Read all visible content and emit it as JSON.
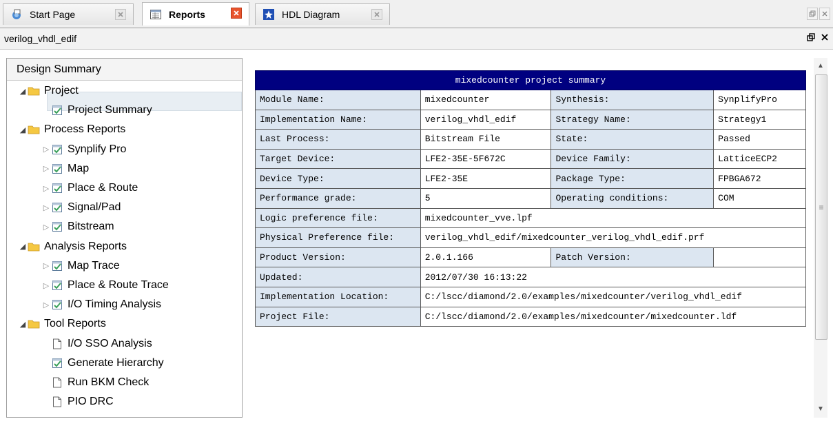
{
  "tabs": [
    {
      "label": "Start Page",
      "icon": "start-page-icon"
    },
    {
      "label": "Reports",
      "icon": "reports-icon",
      "active": true
    },
    {
      "label": "HDL Diagram",
      "icon": "hdl-diagram-icon"
    }
  ],
  "titlebar": {
    "title": "verilog_vhdl_edif"
  },
  "tree": {
    "header": "Design Summary",
    "items": [
      {
        "label": "Project",
        "icon": "folder-icon",
        "level": 0,
        "expanded": true
      },
      {
        "label": "Project Summary",
        "icon": "report-check-icon",
        "level": 1,
        "selected": true
      },
      {
        "label": "Process Reports",
        "icon": "folder-icon",
        "level": 0,
        "expanded": true
      },
      {
        "label": "Synplify Pro",
        "icon": "report-check-icon",
        "level": 1,
        "expandable": true
      },
      {
        "label": "Map",
        "icon": "report-check-icon",
        "level": 1,
        "expandable": true
      },
      {
        "label": "Place & Route",
        "icon": "report-check-icon",
        "level": 1,
        "expandable": true
      },
      {
        "label": "Signal/Pad",
        "icon": "report-check-icon",
        "level": 1,
        "expandable": true
      },
      {
        "label": "Bitstream",
        "icon": "report-check-icon",
        "level": 1,
        "expandable": true
      },
      {
        "label": "Analysis Reports",
        "icon": "folder-icon",
        "level": 0,
        "expanded": true
      },
      {
        "label": "Map Trace",
        "icon": "report-check-icon",
        "level": 1,
        "expandable": true
      },
      {
        "label": "Place & Route Trace",
        "icon": "report-check-icon",
        "level": 1,
        "expandable": true
      },
      {
        "label": "I/O Timing Analysis",
        "icon": "report-check-icon",
        "level": 1,
        "expandable": true
      },
      {
        "label": "Tool Reports",
        "icon": "folder-icon",
        "level": 0,
        "expanded": true
      },
      {
        "label": "I/O SSO Analysis",
        "icon": "document-icon",
        "level": 1
      },
      {
        "label": "Generate Hierarchy",
        "icon": "report-check-icon",
        "level": 1
      },
      {
        "label": "Run BKM Check",
        "icon": "document-icon",
        "level": 1
      },
      {
        "label": "PIO DRC",
        "icon": "document-icon",
        "level": 1
      }
    ]
  },
  "summary": {
    "title": "mixedcounter project summary",
    "rows": [
      [
        "Module Name:",
        "mixedcounter",
        "Synthesis:",
        "SynplifyPro"
      ],
      [
        "Implementation Name:",
        "verilog_vhdl_edif",
        "Strategy Name:",
        "Strategy1"
      ],
      [
        "Last Process:",
        "Bitstream File",
        "State:",
        "Passed"
      ],
      [
        "Target Device:",
        "LFE2-35E-5F672C",
        "Device Family:",
        "LatticeECP2"
      ],
      [
        "Device Type:",
        "LFE2-35E",
        "Package Type:",
        "FPBGA672"
      ],
      [
        "Performance grade:",
        "5",
        "Operating conditions:",
        "COM"
      ],
      [
        "Logic preference file:",
        "mixedcounter_vve.lpf"
      ],
      [
        "Physical Preference file:",
        "verilog_vhdl_edif/mixedcounter_verilog_vhdl_edif.prf"
      ],
      [
        "Product Version:",
        "2.0.1.166",
        "Patch Version:",
        ""
      ],
      [
        "Updated:",
        "2012/07/30 16:13:22"
      ],
      [
        "Implementation Location:",
        "C:/lscc/diamond/2.0/examples/mixedcounter/verilog_vhdl_edif"
      ],
      [
        "Project File:",
        "C:/lscc/diamond/2.0/examples/mixedcounter/mixedcounter.ldf"
      ]
    ]
  },
  "colors": {
    "table_header_bg": "#000080",
    "label_cell_bg": "#dce6f1",
    "folder": "#f5c842",
    "check": "#3aa05a"
  }
}
